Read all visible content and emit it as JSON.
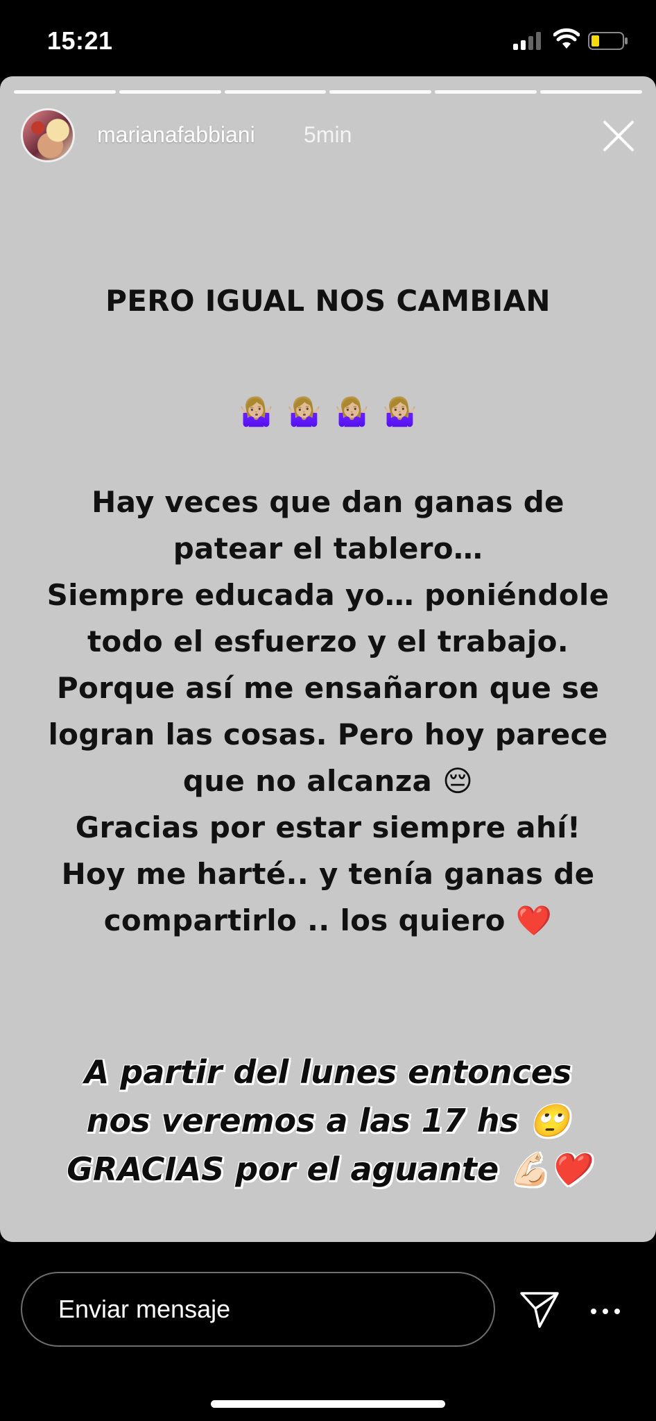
{
  "status_bar": {
    "time": "15:21"
  },
  "story": {
    "username": "marianafabbiani",
    "time_ago": "5min",
    "segments": 6,
    "title": "PERO IGUAL NOS CAMBIAN",
    "title_emoji": [
      "🤷🏼‍♀️",
      "🤷🏼‍♀️",
      "🤷🏼‍♀️",
      "🤷🏼‍♀️"
    ],
    "body_lines": [
      "Hay veces que dan ganas de",
      "patear el tablero…",
      "Siempre educada yo… poniéndole",
      "todo el esfuerzo y el trabajo.",
      "Porque así me ensañaron que se",
      "logran las cosas. Pero hoy parece",
      "que no alcanza 😔",
      "Gracias por estar siempre ahí!",
      "Hoy me harté.. y tenía ganas de",
      "compartirlo .. los quiero ❤️"
    ],
    "closing_lines": [
      "A partir del lunes entonces",
      "nos veremos a las 17 hs 🙄",
      "GRACIAS por el aguante 💪🏻❤️"
    ]
  },
  "footer": {
    "message_placeholder": "Enviar mensaje",
    "send_icon": "paper-plane-icon",
    "more_icon": "ellipsis-icon"
  },
  "colors": {
    "story_bg": "#c8c8c8",
    "text": "#111111",
    "footer_bg": "#000000"
  }
}
